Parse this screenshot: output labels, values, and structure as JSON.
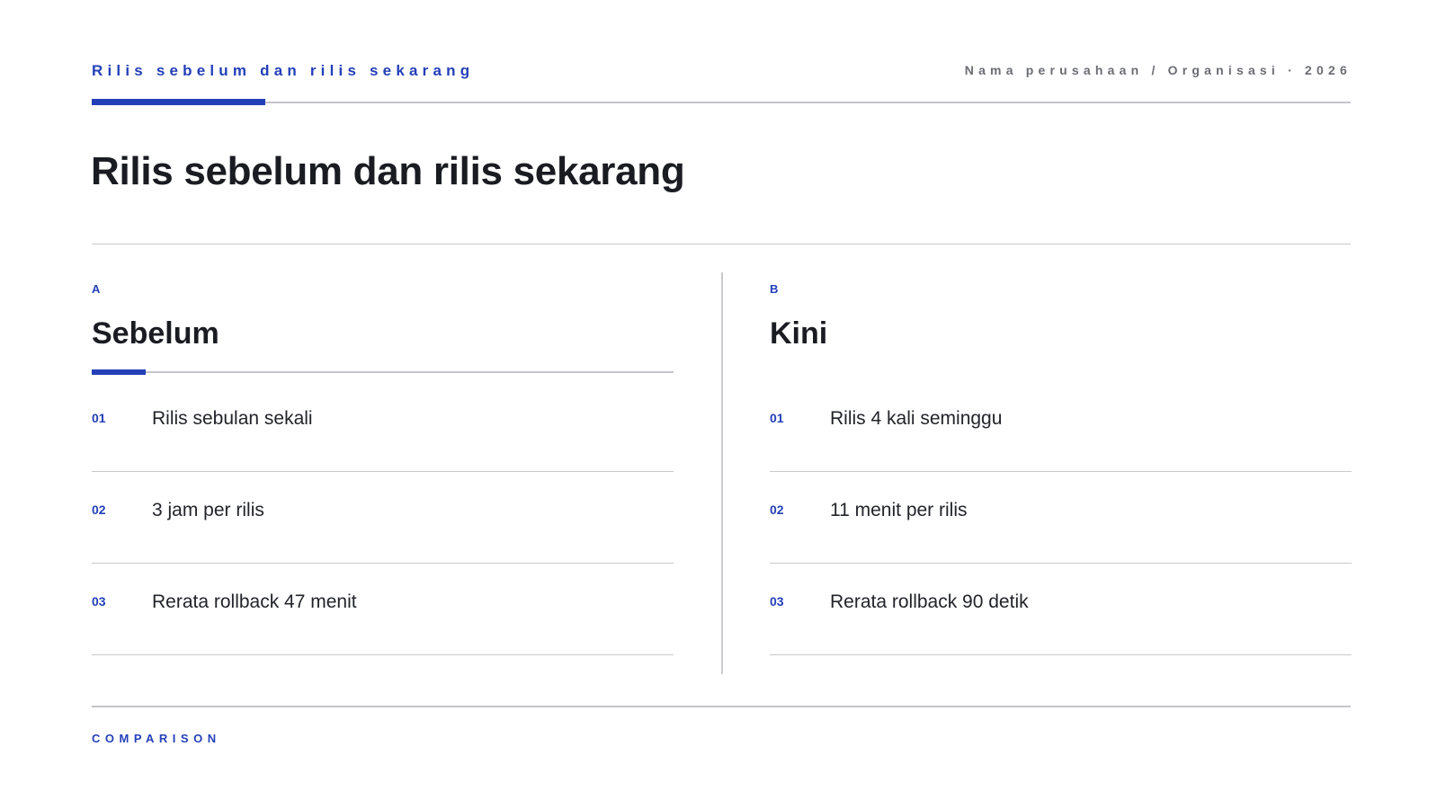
{
  "header": {
    "eyebrow": "Rilis sebelum dan rilis sekarang",
    "organization": "Nama perusahaan / Organisasi · 2026"
  },
  "title": "Rilis sebelum dan rilis sekarang",
  "columns": [
    {
      "letter": "A",
      "heading": "Sebelum",
      "items": [
        {
          "num": "01",
          "text": "Rilis sebulan sekali"
        },
        {
          "num": "02",
          "text": "3 jam per rilis"
        },
        {
          "num": "03",
          "text": "Rerata rollback 47 menit"
        }
      ]
    },
    {
      "letter": "B",
      "heading": "Kini",
      "items": [
        {
          "num": "01",
          "text": "Rilis 4 kali seminggu"
        },
        {
          "num": "02",
          "text": "11 menit per rilis"
        },
        {
          "num": "03",
          "text": "Rerata rollback 90 detik"
        }
      ]
    }
  ],
  "footer": {
    "label": "COMPARISON"
  },
  "colors": {
    "accent": "#2440b8",
    "rule": "#c9cacd",
    "text": "#1a1c22",
    "muted": "#6b6d73"
  }
}
